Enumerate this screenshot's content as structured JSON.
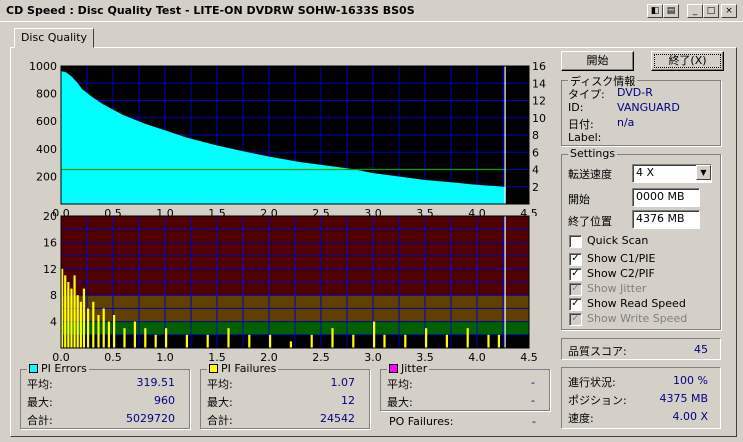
{
  "window": {
    "title": "CD Speed : Disc Quality Test - LITE-ON DVDRW SOHW-1633S BS0S",
    "min_glyph": "_",
    "max_glyph": "□",
    "close_glyph": "×",
    "extra_glyph1": "◧",
    "extra_glyph2": "▤"
  },
  "tab": {
    "label": "Disc Quality"
  },
  "buttons": {
    "start": "開始",
    "end": "終了(X)"
  },
  "disc_info": {
    "title": "ディスク情報",
    "type_label": "タイプ:",
    "type_value": "DVD-R",
    "id_label": "ID:",
    "id_value": "VANGUARD",
    "date_label": "日付:",
    "date_value": "n/a",
    "label_label": "Label:",
    "label_value": ""
  },
  "settings": {
    "title": "Settings",
    "speed_label": "転送速度",
    "speed_value": "4 X",
    "start_label": "開始",
    "start_value": "0000 MB",
    "end_label": "終了位置",
    "end_value": "4376 MB",
    "quick_scan": {
      "label": "Quick Scan",
      "checked": false
    },
    "show_c1": {
      "label": "Show C1/PIE",
      "checked": true
    },
    "show_c2": {
      "label": "Show C2/PIF",
      "checked": true
    },
    "show_jitter": {
      "label": "Show Jitter",
      "checked": true
    },
    "show_read": {
      "label": "Show Read Speed",
      "checked": true
    },
    "show_write": {
      "label": "Show Write Speed",
      "checked": true
    }
  },
  "quality": {
    "label": "品質スコア:",
    "value": "45"
  },
  "progress": {
    "progress_label": "進行状況:",
    "progress_value": "100 %",
    "position_label": "ポジション:",
    "position_value": "4375 MB",
    "speed_label": "速度:",
    "speed_value": "4.00 X"
  },
  "pi_errors": {
    "title": "PI Errors",
    "color": "#00ffff",
    "avg_label": "平均:",
    "avg": "319.51",
    "max_label": "最大:",
    "max": "960",
    "total_label": "合計:",
    "total": "5029720"
  },
  "pi_failures": {
    "title": "PI Failures",
    "color": "#ffff00",
    "avg_label": "平均:",
    "avg": "1.07",
    "max_label": "最大:",
    "max": "12",
    "total_label": "合計:",
    "total": "24542"
  },
  "jitter": {
    "title": "Jitter",
    "color": "#ff00ff",
    "avg_label": "平均:",
    "avg": "-",
    "max_label": "最大:",
    "max": "-"
  },
  "po_failures": {
    "label": "PO Failures:",
    "value": "-"
  },
  "chart_data": [
    {
      "type": "area",
      "series": [
        {
          "name": "PI Errors",
          "color": "#00ffff",
          "x": [
            0.0,
            0.05,
            0.1,
            0.15,
            0.2,
            0.3,
            0.4,
            0.5,
            0.6,
            0.8,
            1.0,
            1.2,
            1.5,
            1.8,
            2.0,
            2.3,
            2.5,
            2.8,
            3.0,
            3.3,
            3.5,
            3.8,
            4.0,
            4.2,
            4.27
          ],
          "y": [
            960,
            950,
            920,
            880,
            830,
            770,
            720,
            680,
            640,
            580,
            530,
            480,
            420,
            370,
            340,
            300,
            280,
            250,
            220,
            190,
            170,
            150,
            135,
            125,
            120
          ]
        },
        {
          "name": "Read Speed",
          "color": "#00a000",
          "x": [
            0,
            4.27
          ],
          "y": [
            4.0,
            4.0
          ]
        }
      ],
      "x_ticks": [
        "0.0",
        "0.5",
        "1.0",
        "1.5",
        "2.0",
        "2.5",
        "3.0",
        "3.5",
        "4.0",
        "4.5"
      ],
      "y_ticks_left": [
        "1000",
        "800",
        "600",
        "400",
        "200"
      ],
      "y_ticks_right": [
        "16",
        "14",
        "12",
        "10",
        "8",
        "6",
        "4",
        "2"
      ],
      "xlim": [
        0,
        4.5
      ],
      "ylim": [
        0,
        1000
      ],
      "y2lim": [
        0,
        16
      ],
      "end_x": 4.27,
      "grid": true
    },
    {
      "type": "bar",
      "series": [
        {
          "name": "PI Failures",
          "color": "#ffff00",
          "x": [
            0.0,
            0.03,
            0.06,
            0.09,
            0.12,
            0.15,
            0.18,
            0.21,
            0.25,
            0.3,
            0.35,
            0.4,
            0.45,
            0.5,
            0.6,
            0.7,
            0.8,
            0.9,
            1.0,
            1.2,
            1.4,
            1.6,
            1.8,
            2.0,
            2.2,
            2.4,
            2.6,
            2.8,
            3.0,
            3.1,
            3.3,
            3.5,
            3.7,
            3.9,
            4.1,
            4.2
          ],
          "y": [
            12,
            11,
            10,
            9,
            11,
            8,
            7,
            9,
            6,
            7,
            5,
            6,
            4,
            5,
            3,
            4,
            3,
            2,
            3,
            2,
            2,
            3,
            2,
            2,
            1,
            2,
            3,
            2,
            4,
            2,
            2,
            3,
            2,
            3,
            2,
            2
          ]
        }
      ],
      "x_ticks": [
        "0.0",
        "0.5",
        "1.0",
        "1.5",
        "2.0",
        "2.5",
        "3.0",
        "3.5",
        "4.0",
        "4.5"
      ],
      "y_ticks_left": [
        "20",
        "16",
        "12",
        "8",
        "4"
      ],
      "xlim": [
        0,
        4.5
      ],
      "ylim": [
        0,
        20
      ],
      "end_x": 4.27,
      "grid": true
    }
  ]
}
